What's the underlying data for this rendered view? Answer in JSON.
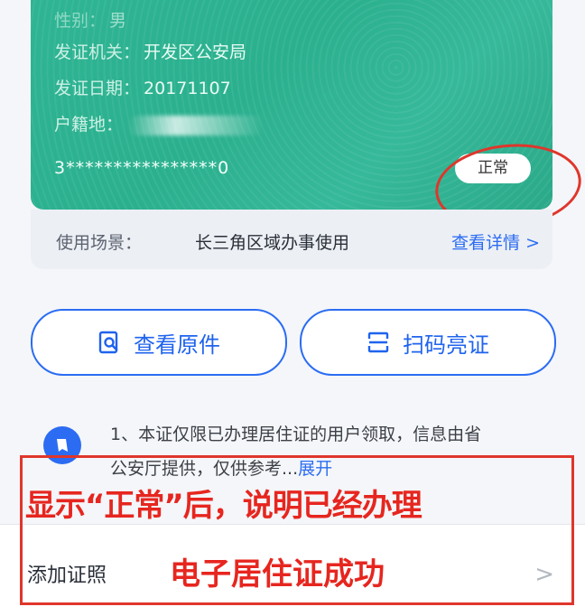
{
  "card": {
    "gender_label": "性别：",
    "gender_value": "男",
    "issuer_label": "发证机关：",
    "issuer_value": "开发区公安局",
    "date_label": "发证日期：",
    "date_value": "20171107",
    "address_label": "户籍地：",
    "id_number": "3****************0",
    "status": "正常"
  },
  "usage": {
    "label": "使用场景：",
    "value": "长三角区域办事使用",
    "link": "查看详情 >"
  },
  "buttons": {
    "view_original": "查看原件",
    "scan_code": "扫码亮证"
  },
  "notice": {
    "line1": "1、本证仅限已办理居住证的用户领取，信息由省",
    "line2": "公安厅提供，仅供参考...",
    "expand": "展开"
  },
  "add_row": {
    "label": "添加证照",
    "chevron": ">"
  },
  "annotation": {
    "line1": "显示“正常”后，说明已经办理",
    "line2": "电子居住证成功"
  },
  "colors": {
    "card_green": "#2fb594",
    "accent_blue": "#2b6cf2",
    "annotation_red": "#e0362b"
  }
}
